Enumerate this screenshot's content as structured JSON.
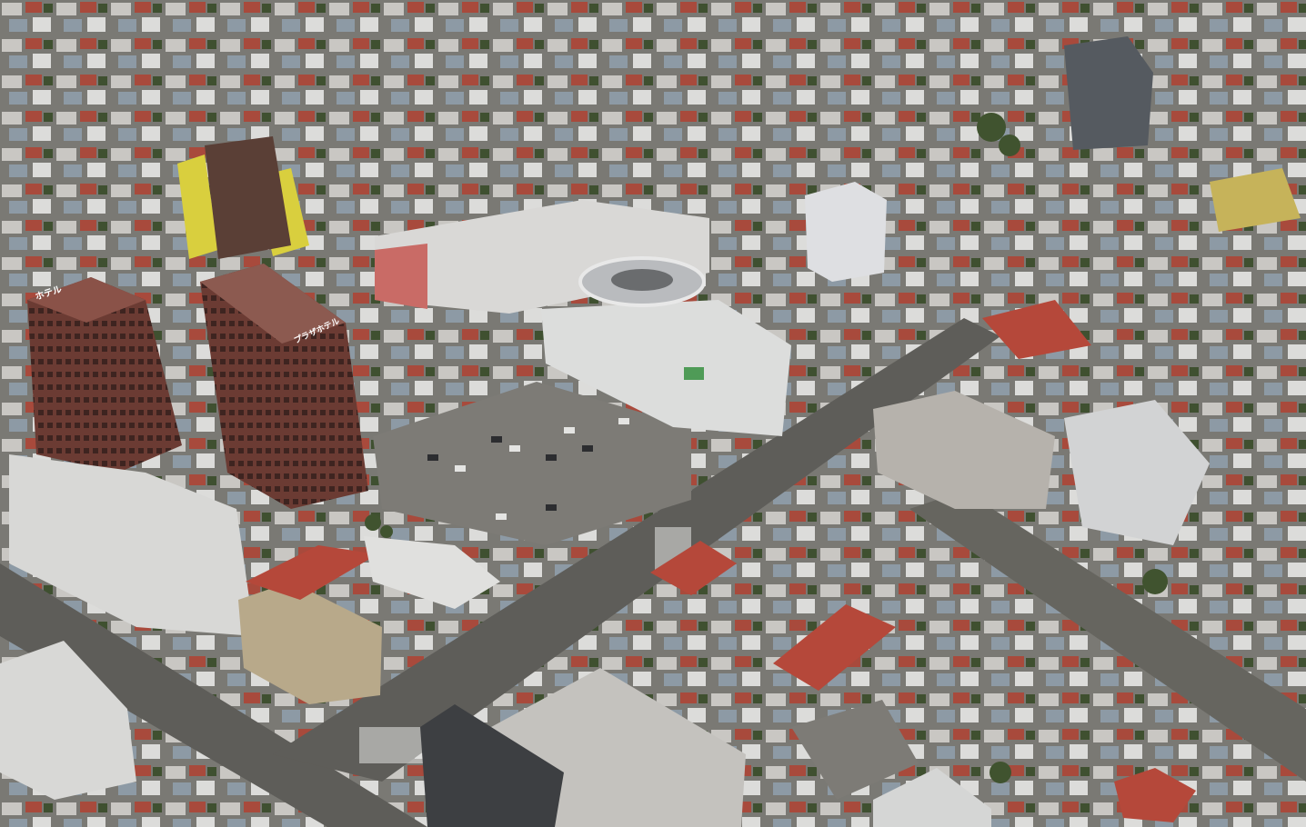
{
  "scene": {
    "type": "aerial-3d-city-view",
    "palette": {
      "ground": "#6f6e68",
      "road": "#5e5d59",
      "lot": "#7d7b76",
      "sidewalk": "#a89a86",
      "roof_red": "#b5483a",
      "roof_white": "#d6d7d6",
      "roof_grey": "#9a9c9e",
      "tower_brick": "#6b3b33",
      "yellow_tower": "#d9cf3e",
      "tree": "#40532f",
      "car_dark": "#2c2d30",
      "car_white": "#e4e4e2"
    },
    "signs": {
      "hotel_left": "ホテル",
      "hotel_center": "プラザホテル"
    }
  }
}
